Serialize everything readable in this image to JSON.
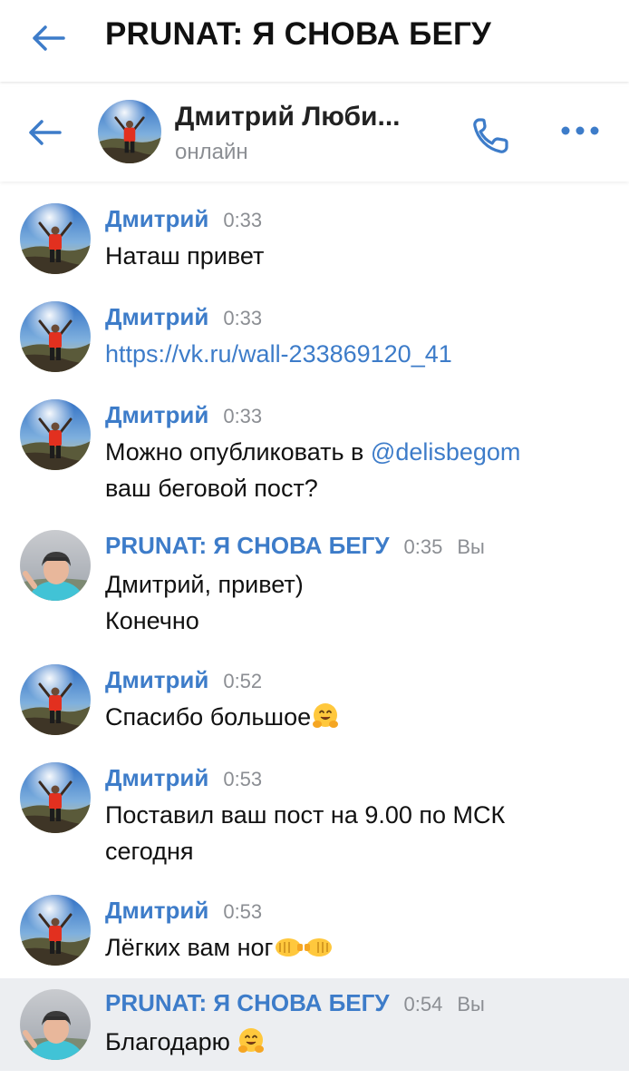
{
  "app": {
    "title": "PRUNAT: Я СНОВА БЕГУ"
  },
  "chat": {
    "name": "Дмитрий Люби...",
    "status": "онлайн"
  },
  "colors": {
    "accent": "#3d7cc9",
    "muted": "#8b8e93",
    "highlight_row": "#eceef1"
  },
  "messages": [
    {
      "author": "Дмитрий",
      "time": "0:33",
      "lines": [
        "Наташ привет"
      ]
    },
    {
      "author": "Дмитрий",
      "time": "0:33",
      "link": "https://vk.ru/wall-233869120_41"
    },
    {
      "author": "Дмитрий",
      "time": "0:33",
      "line1_prefix": "Можно опубликовать в ",
      "mention": "@delisbegom",
      "line2": "ваш беговой пост?"
    },
    {
      "author": "PRUNAT: Я СНОВА БЕГУ",
      "time": "0:35",
      "you": "Вы",
      "lines": [
        "Дмитрий, привет)",
        "Конечно"
      ]
    },
    {
      "author": "Дмитрий",
      "time": "0:52",
      "text": "Спасибо большое",
      "emoji": "hugging-face"
    },
    {
      "author": "Дмитрий",
      "time": "0:53",
      "lines": [
        "Поставил ваш пост на 9.00 по МСК",
        "сегодня"
      ]
    },
    {
      "author": "Дмитрий",
      "time": "0:53",
      "text": "Лёгких вам ног",
      "emoji": "fist-bump"
    },
    {
      "author": "PRUNAT: Я СНОВА БЕГУ",
      "time": "0:54",
      "you": "Вы",
      "text": "Благодарю ",
      "emoji": "hugging-face"
    }
  ]
}
